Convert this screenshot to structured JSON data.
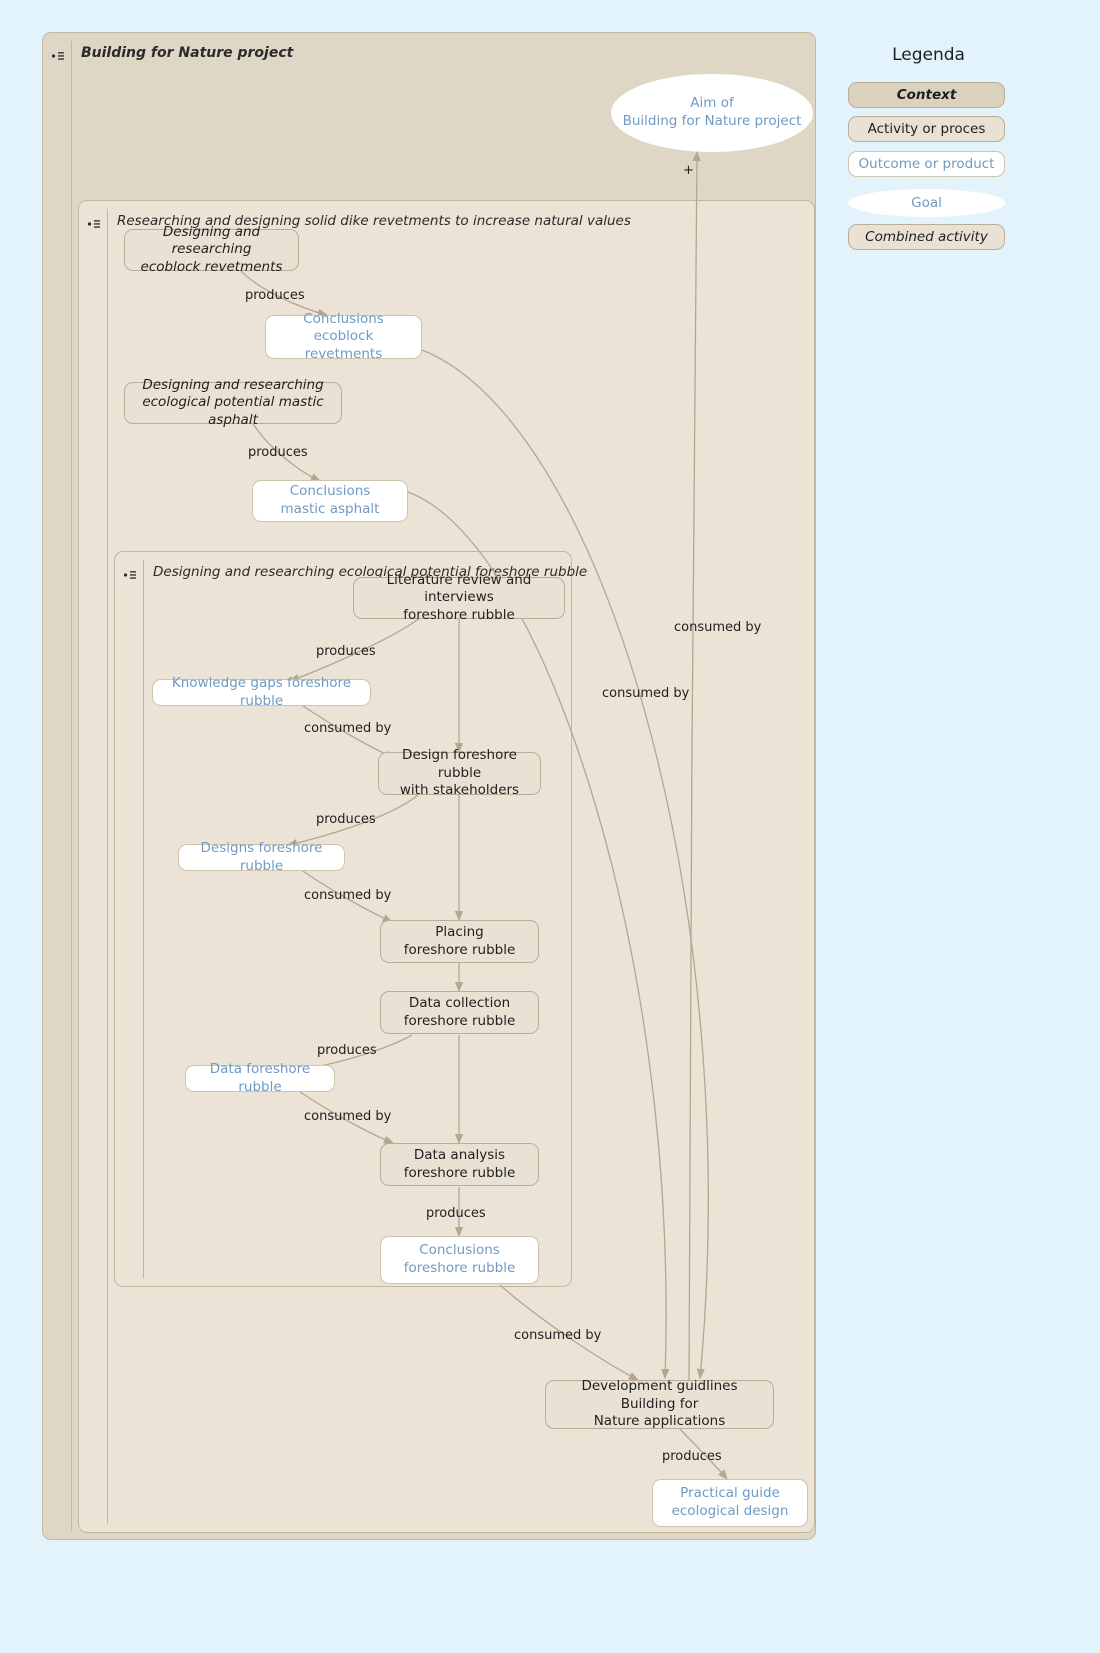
{
  "page": {
    "background_color": "#e2f3fb",
    "type": "process-flow-diagram"
  },
  "legend": {
    "title": "Legenda",
    "items": [
      {
        "label": "Context",
        "style": "context"
      },
      {
        "label": "Activity or proces",
        "style": "activity"
      },
      {
        "label": "Outcome or product",
        "style": "outcome"
      },
      {
        "label": "Goal",
        "style": "goal"
      },
      {
        "label": "Combined activity",
        "style": "combined"
      }
    ]
  },
  "clusters": [
    {
      "id": "c-project",
      "title": "Building for Nature project"
    },
    {
      "id": "c-revetments",
      "title": "Researching and designing solid dike revetments to increase natural values"
    },
    {
      "id": "c-foreshore",
      "title": "Designing and researching ecological potential foreshore rubble"
    }
  ],
  "nodes": {
    "goal_aim": {
      "line1": "Aim of",
      "line2": "Building for Nature project",
      "type": "goal"
    },
    "act_ecoblock": {
      "line1": "Designing and researching",
      "line2": "ecoblock revetments",
      "type": "context"
    },
    "out_ecoblock": {
      "line1": "Conclusions",
      "line2": "ecoblock revetments",
      "type": "outcome"
    },
    "act_mastic": {
      "line1": "Designing and researching",
      "line2": "ecological potential mastic asphalt",
      "type": "context"
    },
    "out_mastic": {
      "line1": "Conclusions",
      "line2": "mastic asphalt",
      "type": "outcome"
    },
    "act_literature": {
      "line1": "Literature review and interviews",
      "line2": "foreshore rubble",
      "type": "activity"
    },
    "out_knowledgegaps": {
      "line1": "Knowledge gaps foreshore rubble",
      "line2": "",
      "type": "outcome"
    },
    "act_design": {
      "line1": "Design foreshore rubble",
      "line2": "with stakeholders",
      "type": "activity"
    },
    "out_designs": {
      "line1": "Designs foreshore rubble",
      "line2": "",
      "type": "outcome"
    },
    "act_placing": {
      "line1": "Placing",
      "line2": "foreshore rubble",
      "type": "activity"
    },
    "act_datacollection": {
      "line1": "Data collection",
      "line2": "foreshore rubble",
      "type": "activity"
    },
    "out_data": {
      "line1": "Data foreshore rubble",
      "line2": "",
      "type": "outcome"
    },
    "act_dataanalysis": {
      "line1": "Data analysis",
      "line2": "foreshore rubble",
      "type": "activity"
    },
    "out_conclusions_fs": {
      "line1": "Conclusions",
      "line2": "foreshore rubble",
      "type": "outcome"
    },
    "act_development": {
      "line1": "Development guidlines Building for",
      "line2": "Nature applications",
      "type": "activity"
    },
    "out_practicalguide": {
      "line1": "Practical guide",
      "line2": "ecological design",
      "type": "outcome"
    }
  },
  "edge_labels": {
    "plus": "+",
    "produces_ecoblock": "produces",
    "produces_mastic": "produces",
    "produces_literature": "produces",
    "consumed_knowledgegaps": "consumed by",
    "produces_design": "produces",
    "consumed_designs": "consumed by",
    "produces_datacollection": "produces",
    "consumed_data": "consumed by",
    "produces_dataanalysis": "produces",
    "consumed_conclusions_fs": "consumed by",
    "consumed_ecoblock": "consumed by",
    "consumed_mastic": "consumed by",
    "produces_development": "produces"
  },
  "colors": {
    "page_background": "#e2f3fb",
    "cluster_outer": "#dfd7c6",
    "cluster_inner": "#eae3d6",
    "node_fill": "#e9e2d4",
    "node_border": "#b9ae95",
    "outcome_text": "#6f9ac4",
    "edge_stroke": "#b3a88e",
    "text": "#1f1f1f"
  }
}
